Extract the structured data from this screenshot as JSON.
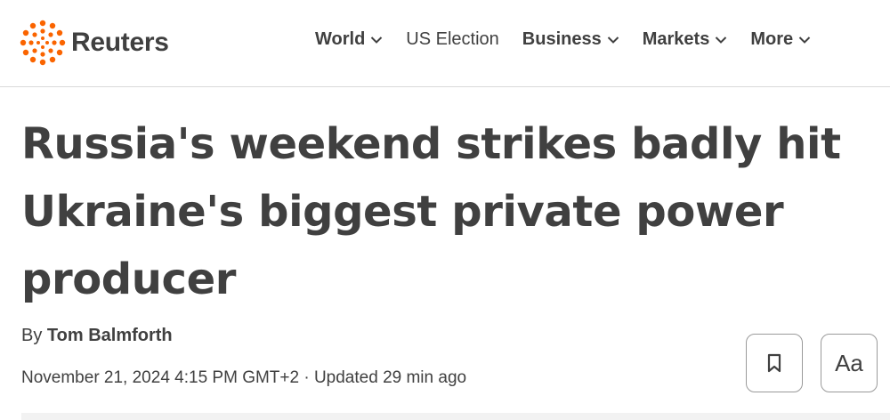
{
  "brand": {
    "name": "Reuters",
    "logo_icon": "reuters-dot-ring-logo",
    "accent_color": "#fa6400"
  },
  "nav": {
    "items": [
      {
        "label": "World",
        "has_dropdown": true
      },
      {
        "label": "US Election",
        "has_dropdown": false
      },
      {
        "label": "Business",
        "has_dropdown": true
      },
      {
        "label": "Markets",
        "has_dropdown": true
      },
      {
        "label": "More",
        "has_dropdown": true
      }
    ]
  },
  "article": {
    "headline": "Russia's weekend strikes badly hit Ukraine's biggest private power producer",
    "byline_prefix": "By",
    "author": "Tom Balmforth",
    "dateline": "November 21, 2024 4:15 PM GMT+2 · Updated 29 min ago"
  },
  "actions": {
    "bookmark_icon": "bookmark-icon",
    "text_size_label": "Aa"
  }
}
